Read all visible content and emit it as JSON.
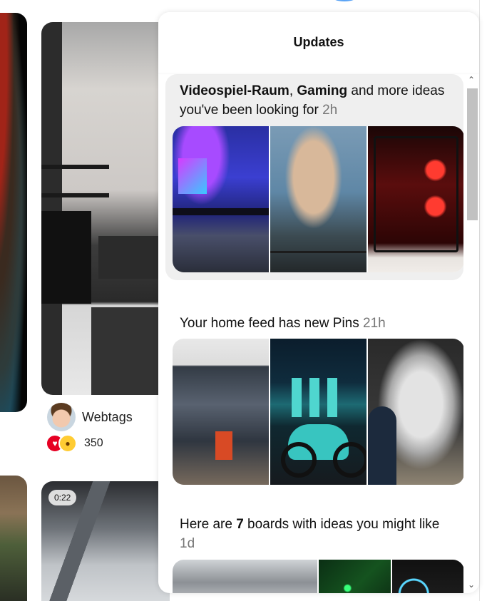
{
  "feed": {
    "pin_creator": "Webtags",
    "reaction_count": "350",
    "reaction_icons": [
      "heart-icon",
      "wow-face-icon"
    ],
    "video_duration": "0:22"
  },
  "updates": {
    "title": "Updates",
    "items": [
      {
        "topic_1": "Videospiel-Raum",
        "separator": ", ",
        "topic_2": "Gaming",
        "rest": " and more ideas you've been looking for ",
        "time": "2h",
        "highlighted": true,
        "thumbnails": [
          "gaming-room",
          "street-art",
          "red-gaming-pc"
        ]
      },
      {
        "text": "Your home feed has new Pins ",
        "time": "21h",
        "highlighted": false,
        "thumbnails": [
          "graffiti-house",
          "marina-bay-motorcycle",
          "horse-painting"
        ]
      },
      {
        "prefix": "Here are ",
        "count": "7",
        "suffix": " boards with ideas you might like ",
        "time": "1d",
        "highlighted": false,
        "thumbnails": [
          "pc-parts",
          "circuit-board",
          "dark-speaker"
        ]
      }
    ]
  },
  "colors": {
    "highlight_bg": "#efefef",
    "time_text": "#767676",
    "reaction_heart": "#e60023",
    "reaction_wow": "#ffcc33"
  }
}
